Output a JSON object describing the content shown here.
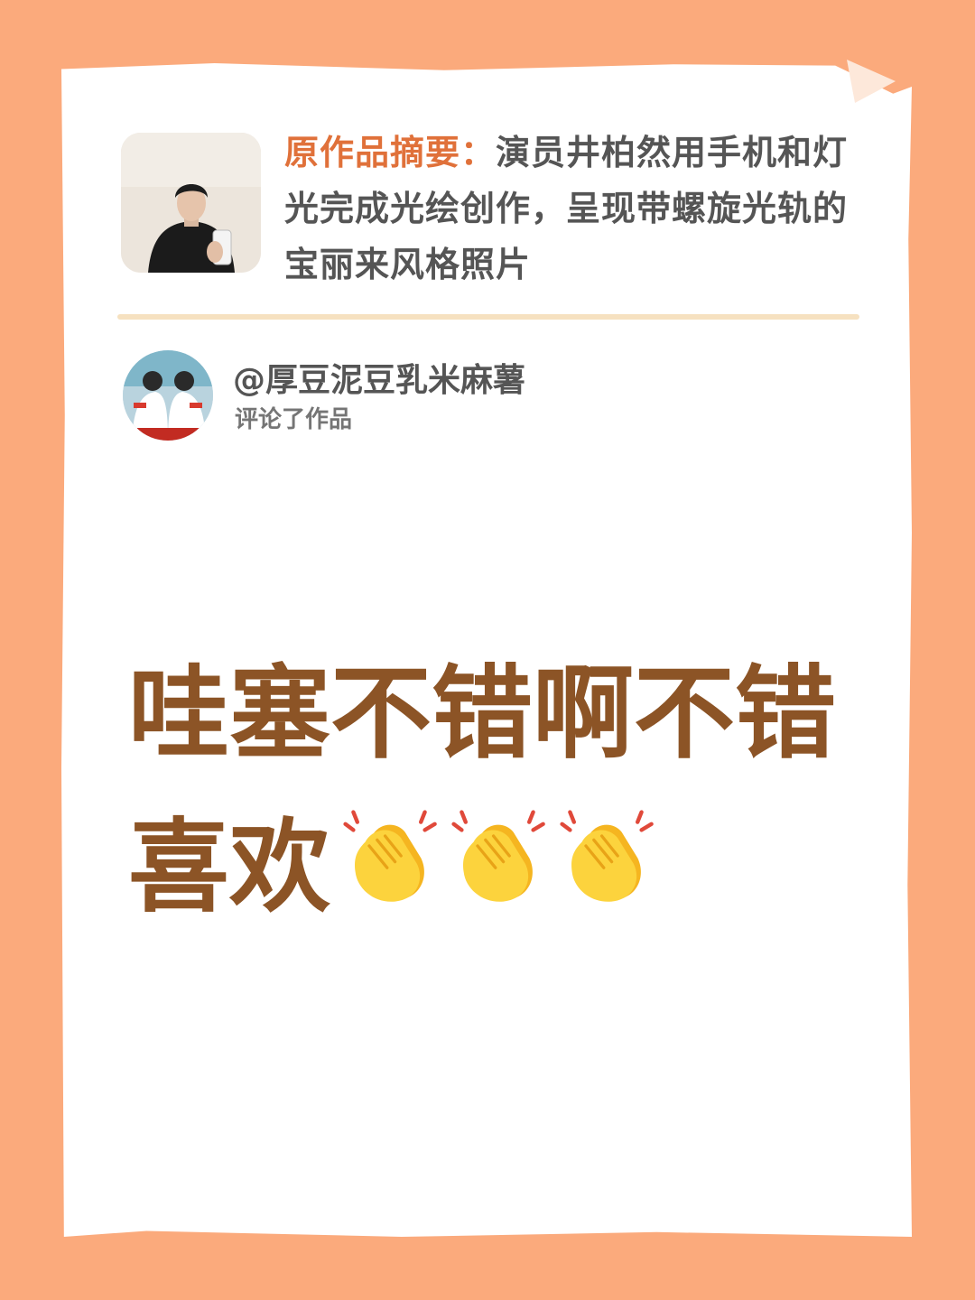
{
  "colors": {
    "background": "#fbaa7c",
    "card": "#ffffff",
    "summary_label": "#e0713a",
    "body_text": "#555555",
    "comment_text": "#8c5426",
    "divider": "#f6e1c0"
  },
  "post": {
    "summary_label": "原作品摘要：",
    "summary_text": "演员井柏然用手机和灯光完成光绘创作，呈现带螺旋光轨的宝丽来风格照片"
  },
  "commenter": {
    "username": "@厚豆泥豆乳米麻薯",
    "action": "评论了作品"
  },
  "comment": {
    "line1": "哇塞不错啊不错",
    "line2": "喜欢",
    "emojis": [
      "clapping-hands-icon",
      "clapping-hands-icon",
      "clapping-hands-icon"
    ]
  }
}
